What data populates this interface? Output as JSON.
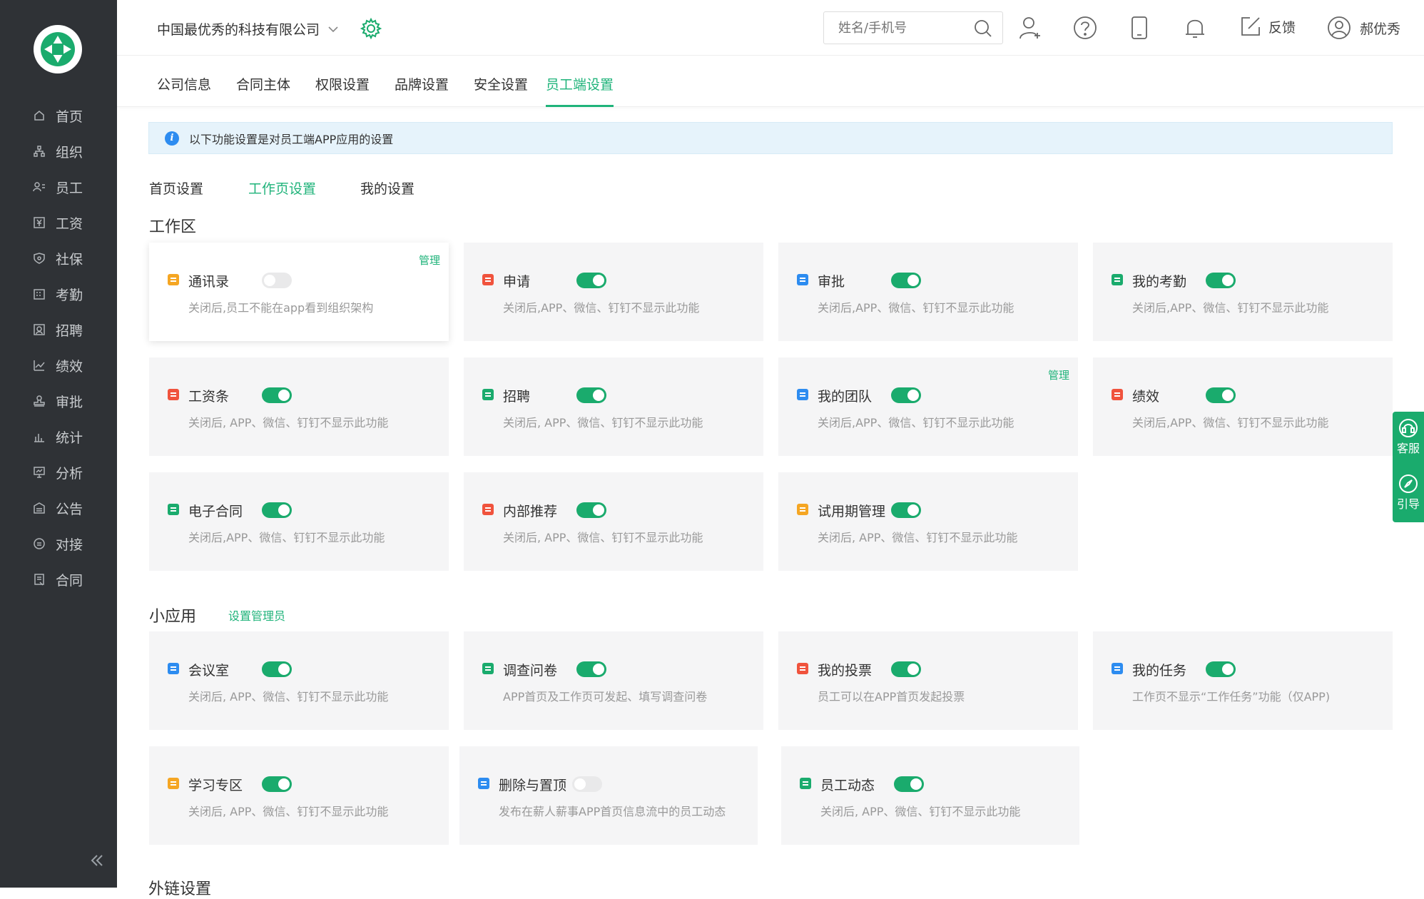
{
  "colors": {
    "accent": "#1fb37a",
    "sidebar_bg": "#2f3236",
    "info": "#2d8cf0"
  },
  "sidebar": {
    "items": [
      {
        "label": "首页",
        "icon": "home-icon"
      },
      {
        "label": "组织",
        "icon": "org-icon"
      },
      {
        "label": "员工",
        "icon": "employee-icon"
      },
      {
        "label": "工资",
        "icon": "salary-icon"
      },
      {
        "label": "社保",
        "icon": "shield-icon"
      },
      {
        "label": "考勤",
        "icon": "calendar-icon"
      },
      {
        "label": "招聘",
        "icon": "recruit-icon"
      },
      {
        "label": "绩效",
        "icon": "chart-line-icon"
      },
      {
        "label": "审批",
        "icon": "stamp-icon"
      },
      {
        "label": "统计",
        "icon": "bar-chart-icon"
      },
      {
        "label": "分析",
        "icon": "analysis-icon"
      },
      {
        "label": "公告",
        "icon": "announce-icon"
      },
      {
        "label": "对接",
        "icon": "link-icon"
      },
      {
        "label": "合同",
        "icon": "contract-icon"
      }
    ]
  },
  "header": {
    "company": "中国最优秀的科技有限公司",
    "search_placeholder": "姓名/手机号",
    "feedback": "反馈",
    "user_name": "郝优秀"
  },
  "tabs": [
    "公司信息",
    "合同主体",
    "权限设置",
    "品牌设置",
    "安全设置",
    "员工端设置"
  ],
  "notice": "以下功能设置是对员工端APP应用的设置",
  "subtabs": [
    "首页设置",
    "工作页设置",
    "我的设置"
  ],
  "workarea": {
    "title": "工作区",
    "manage": "管理",
    "cards": [
      {
        "name": "通讯录",
        "desc": "关闭后,员工不能在app看到组织架构",
        "on": false,
        "icon": "contacts-icon",
        "color": "#f5a623"
      },
      {
        "name": "申请",
        "desc": "关闭后,APP、微信、钉钉不显示此功能",
        "on": true,
        "icon": "apply-icon",
        "color": "#f0533d"
      },
      {
        "name": "审批",
        "desc": "关闭后,APP、微信、钉钉不显示此功能",
        "on": true,
        "icon": "approval-icon",
        "color": "#2d8cf0"
      },
      {
        "name": "我的考勤",
        "desc": "关闭后,APP、微信、钉钉不显示此功能",
        "on": true,
        "icon": "location-icon",
        "color": "#1aab6d"
      },
      {
        "name": "工资条",
        "desc": "关闭后, APP、微信、钉钉不显示此功能",
        "on": true,
        "icon": "payslip-icon",
        "color": "#f0533d"
      },
      {
        "name": "招聘",
        "desc": "关闭后, APP、微信、钉钉不显示此功能",
        "on": true,
        "icon": "recruit-card-icon",
        "color": "#1aab6d"
      },
      {
        "name": "我的团队",
        "desc": "关闭后,APP、微信、钉钉不显示此功能",
        "on": true,
        "icon": "team-icon",
        "color": "#2d8cf0"
      },
      {
        "name": "绩效",
        "desc": "关闭后,APP、微信、钉钉不显示此功能",
        "on": true,
        "icon": "performance-icon",
        "color": "#f0533d"
      },
      {
        "name": "电子合同",
        "desc": "关闭后,APP、微信、钉钉不显示此功能",
        "on": true,
        "icon": "e-contract-icon",
        "color": "#1aab6d"
      },
      {
        "name": "内部推荐",
        "desc": "关闭后, APP、微信、钉钉不显示此功能",
        "on": true,
        "icon": "flame-icon",
        "color": "#f0533d"
      },
      {
        "name": "试用期管理",
        "desc": "关闭后, APP、微信、钉钉不显示此功能",
        "on": true,
        "icon": "probation-icon",
        "color": "#f5a623"
      }
    ]
  },
  "miniapps": {
    "title": "小应用",
    "admin_link": "设置管理员",
    "cards": [
      {
        "name": "会议室",
        "desc": "关闭后, APP、微信、钉钉不显示此功能",
        "on": true,
        "icon": "meeting-room-icon",
        "color": "#2d8cf0"
      },
      {
        "name": "调查问卷",
        "desc": "APP首页及工作页可发起、填写调查问卷",
        "on": true,
        "icon": "survey-icon",
        "color": "#1aab6d"
      },
      {
        "name": "我的投票",
        "desc": "员工可以在APP首页发起投票",
        "on": true,
        "icon": "vote-icon",
        "color": "#f0533d"
      },
      {
        "name": "我的任务",
        "desc": "工作页不显示“工作任务”功能（仅APP)",
        "on": true,
        "icon": "task-icon",
        "color": "#2d8cf0"
      },
      {
        "name": "学习专区",
        "desc": "关闭后, APP、微信、钉钉不显示此功能",
        "on": true,
        "icon": "study-icon",
        "color": "#f5a623"
      },
      {
        "name": "删除与置顶",
        "desc": "发布在薪人薪事APP首页信息流中的员工动态",
        "on": false,
        "icon": "settings-badge-icon",
        "color": "#2d8cf0"
      },
      {
        "name": "员工动态",
        "desc": "关闭后, APP、微信、钉钉不显示此功能",
        "on": true,
        "icon": "compass-icon",
        "color": "#1aab6d"
      }
    ]
  },
  "footer_title": "外链设置",
  "floatbar": {
    "service": "客服",
    "guide": "引导"
  }
}
